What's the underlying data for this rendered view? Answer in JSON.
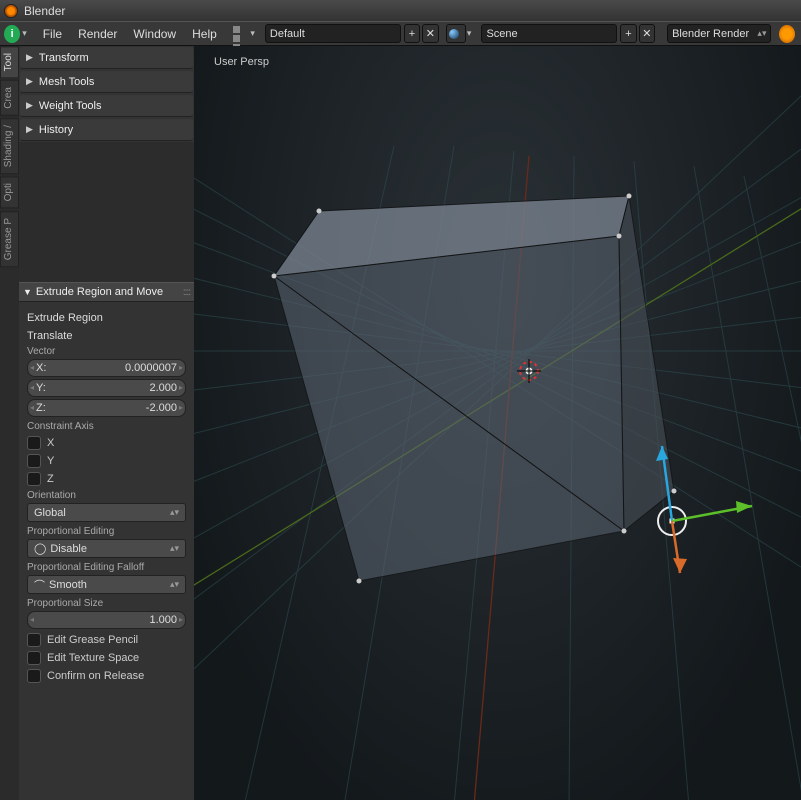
{
  "titlebar": {
    "title": "Blender"
  },
  "header": {
    "menus": [
      "File",
      "Render",
      "Window",
      "Help"
    ],
    "layout_selector": "Default",
    "scene_selector": "Scene",
    "render_engine": "Blender Render"
  },
  "vtabs": [
    "Tool",
    "Crea",
    "Shading /",
    "Opti",
    "Grease P"
  ],
  "tool_panels": [
    "Transform",
    "Mesh Tools",
    "Weight Tools",
    "History"
  ],
  "operator": {
    "title": "Extrude Region and Move",
    "labels": {
      "extrude": "Extrude Region",
      "translate": "Translate"
    },
    "vector_label": "Vector",
    "vector": {
      "x_label": "X:",
      "x": "0.0000007",
      "y_label": "Y:",
      "y": "2.000",
      "z_label": "Z:",
      "z": "-2.000"
    },
    "constraint_label": "Constraint Axis",
    "constraint": {
      "x": "X",
      "y": "Y",
      "z": "Z"
    },
    "orientation_label": "Orientation",
    "orientation": "Global",
    "prop_edit_label": "Proportional Editing",
    "prop_edit": "Disable",
    "prop_falloff_label": "Proportional Editing Falloff",
    "prop_falloff": "Smooth",
    "prop_size_label": "Proportional Size",
    "prop_size": "1.000",
    "checks": {
      "grease": "Edit Grease Pencil",
      "texture": "Edit Texture Space",
      "confirm": "Confirm on Release"
    }
  },
  "viewport": {
    "label": "User Persp"
  }
}
